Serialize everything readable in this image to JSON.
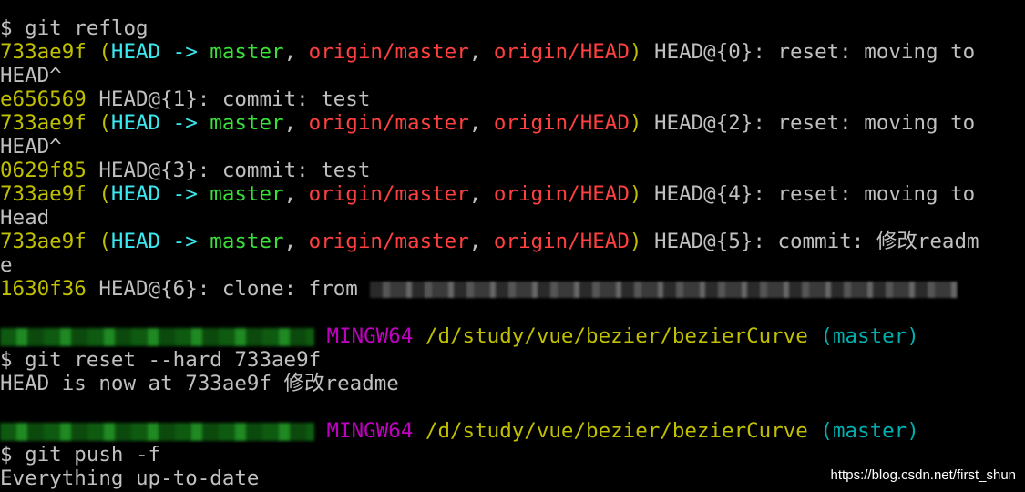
{
  "terminal": {
    "top_partial": "sunyu@LAPTOP-BCFD5J5 MINGW64 /d/study/vue/bezier/bezierCurve (master)",
    "cmd1": "$ git reflog",
    "reflog": [
      {
        "hash": "733ae9f",
        "refs": true,
        "rest": " HEAD@{0}: reset: moving to",
        "wrap": "HEAD^"
      },
      {
        "hash": "e656569",
        "refs": false,
        "rest": " HEAD@{1}: commit: test",
        "wrap": ""
      },
      {
        "hash": "733ae9f",
        "refs": true,
        "rest": " HEAD@{2}: reset: moving to",
        "wrap": "HEAD^"
      },
      {
        "hash": "0629f85",
        "refs": false,
        "rest": " HEAD@{3}: commit: test",
        "wrap": ""
      },
      {
        "hash": "733ae9f",
        "refs": true,
        "rest": " HEAD@{4}: reset: moving to",
        "wrap": "Head"
      },
      {
        "hash": "733ae9f",
        "refs": true,
        "rest": " HEAD@{5}: commit: 修改readm",
        "wrap": "e"
      },
      {
        "hash": "1630f36",
        "refs": false,
        "rest": " HEAD@{6}: clone: from ",
        "wrap": ""
      }
    ],
    "refs_labels": {
      "open": " (",
      "head": "HEAD",
      "arrow": " -> ",
      "master": "master",
      "comma1": ", ",
      "origin_master": "origin/master",
      "comma2": ", ",
      "origin_head": "origin/HEAD",
      "close": ")"
    },
    "prompt": {
      "mingw": "MINGW64",
      "path": "/d/study/vue/bezier/bezierCurve",
      "branch": "(master)"
    },
    "cmd2": "$ git reset --hard 733ae9f",
    "out2": "HEAD is now at 733ae9f 修改readme",
    "cmd3": "$ git push -f",
    "out3": "Everything up-to-date"
  },
  "watermark": "https://blog.csdn.net/first_shun"
}
